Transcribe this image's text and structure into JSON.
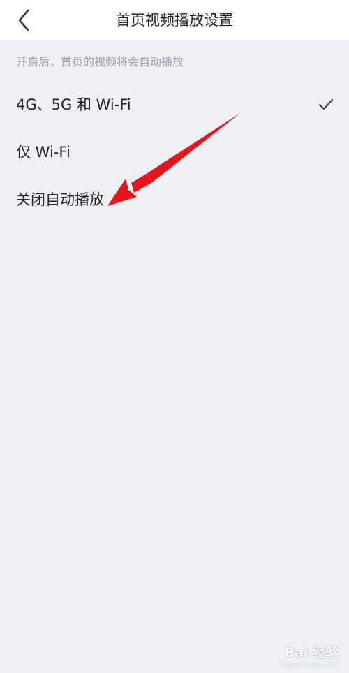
{
  "header": {
    "title": "首页视频播放设置",
    "back_icon": "chevron-left-icon"
  },
  "hint": "开启后，首页的视频将会自动播放",
  "options": [
    {
      "label": "4G、5G 和 Wi-Fi",
      "selected": true
    },
    {
      "label": "仅 Wi-Fi",
      "selected": false
    },
    {
      "label": "关闭自动播放",
      "selected": false
    }
  ],
  "colors": {
    "background": "#eef0f5",
    "header_background": "#ffffff",
    "hint_text": "#9a9da6",
    "annotation_arrow": "#e8141c"
  },
  "watermark": {
    "logo": "Bai 经验",
    "domain": "jingyan.baidu.com"
  }
}
